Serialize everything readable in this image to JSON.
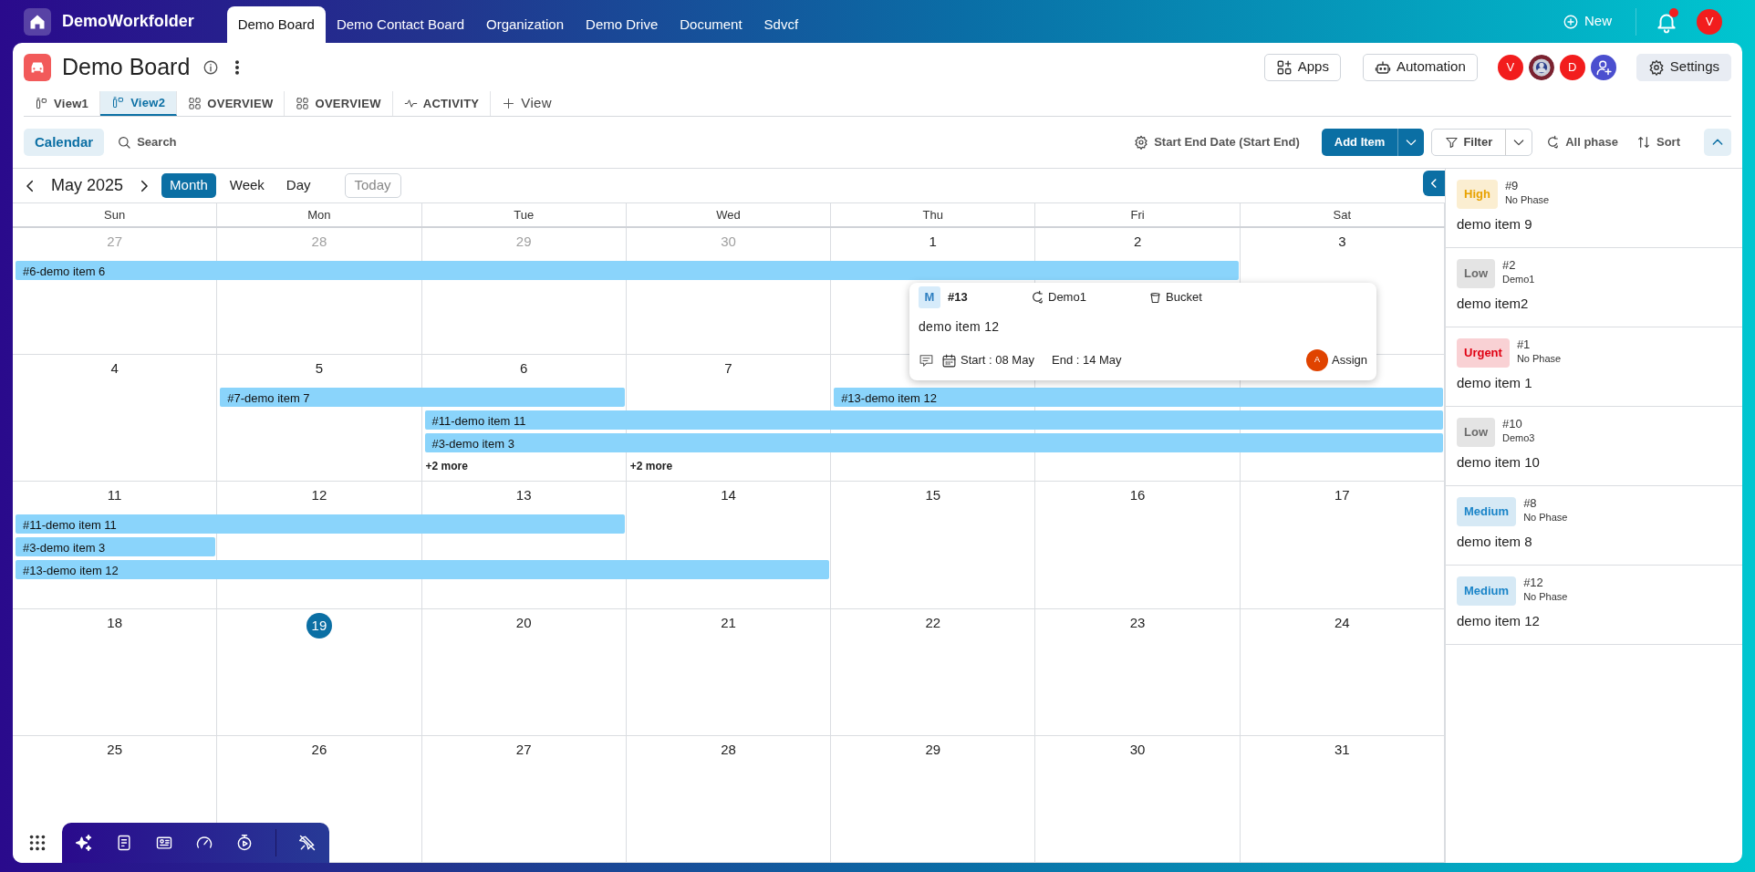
{
  "top_nav": {
    "brand": "DemoWorkfolder",
    "tabs": [
      {
        "label": "Demo Board",
        "selected": true
      },
      {
        "label": "Demo Contact Board",
        "selected": false
      },
      {
        "label": "Organization",
        "selected": false
      },
      {
        "label": "Demo Drive",
        "selected": false
      },
      {
        "label": "Document",
        "selected": false
      },
      {
        "label": "Sdvcf",
        "selected": false
      }
    ],
    "new_button": "New",
    "notifications": {
      "unread": true
    },
    "user_initial": "V"
  },
  "board": {
    "title": "Demo Board",
    "views": [
      {
        "label": "View1",
        "kind": "board",
        "selected": false
      },
      {
        "label": "View2",
        "kind": "board",
        "selected": true
      },
      {
        "label": "OVERVIEW",
        "kind": "overview",
        "selected": false
      },
      {
        "label": "OVERVIEW",
        "kind": "overview",
        "selected": false
      },
      {
        "label": "ACTIVITY",
        "kind": "activity",
        "selected": false
      }
    ],
    "add_view": "View",
    "apps_button": "Apps",
    "automation_button": "Automation",
    "members": [
      {
        "kind": "letter",
        "initial": "V"
      },
      {
        "kind": "picture"
      },
      {
        "kind": "letter",
        "initial": "D"
      }
    ],
    "settings_button": "Settings"
  },
  "toolbar": {
    "calendar_tab": "Calendar",
    "search": "Search",
    "date_fields": "Start End Date (Start End)",
    "add_item": "Add Item",
    "filter": "Filter",
    "phase": "All phase",
    "sort": "Sort"
  },
  "calendar": {
    "month": "May 2025",
    "modes": [
      {
        "label": "Month",
        "selected": true
      },
      {
        "label": "Week",
        "selected": false
      },
      {
        "label": "Day",
        "selected": false
      }
    ],
    "today_button": {
      "label": "Today",
      "disabled": true
    },
    "weekdays": [
      "Sun",
      "Mon",
      "Tue",
      "Wed",
      "Thu",
      "Fri",
      "Sat"
    ],
    "weeks": [
      {
        "days": [
          {
            "label": "27",
            "kind": "outside"
          },
          {
            "label": "28",
            "kind": "outside"
          },
          {
            "label": "29",
            "kind": "outside"
          },
          {
            "label": "30",
            "kind": "outside"
          },
          {
            "label": "1",
            "kind": "current"
          },
          {
            "label": "2",
            "kind": "current"
          },
          {
            "label": "3",
            "kind": "current"
          }
        ],
        "lanes": [
          [
            {
              "kind": "start",
              "label": "#6-demo item 6"
            },
            {
              "kind": "continue"
            },
            {
              "kind": "continue"
            },
            {
              "kind": "continue"
            },
            {
              "kind": "continue"
            },
            {
              "kind": "continue"
            }
          ]
        ]
      },
      {
        "days": [
          {
            "label": "4",
            "kind": "current"
          },
          {
            "label": "5",
            "kind": "current"
          },
          {
            "label": "6",
            "kind": "current"
          },
          {
            "label": "7",
            "kind": "current"
          },
          {
            "kind": "covered"
          },
          {
            "kind": "covered"
          },
          {
            "kind": "covered"
          }
        ],
        "lanes": [
          [
            {
              "kind": "empty"
            },
            {
              "kind": "start",
              "label": "#7-demo item 7"
            },
            {
              "kind": "continue"
            },
            {
              "kind": "empty"
            },
            {
              "kind": "start",
              "label": "#13-demo item 12"
            },
            {
              "kind": "continue"
            },
            {
              "kind": "continue"
            }
          ],
          [
            {
              "kind": "empty"
            },
            {
              "kind": "empty"
            },
            {
              "kind": "start",
              "label": "#11-demo item 11"
            },
            {
              "kind": "continue"
            },
            {
              "kind": "continue"
            },
            {
              "kind": "continue"
            },
            {
              "kind": "continue"
            }
          ],
          [
            {
              "kind": "empty"
            },
            {
              "kind": "empty"
            },
            {
              "kind": "start",
              "label": "#3-demo item 3"
            },
            {
              "kind": "continue"
            },
            {
              "kind": "continue"
            },
            {
              "kind": "continue"
            },
            {
              "kind": "continue"
            }
          ],
          [
            {
              "kind": "empty"
            },
            {
              "kind": "empty"
            },
            {
              "kind": "more",
              "label": "+2 more"
            },
            {
              "kind": "more",
              "label": "+2 more"
            }
          ]
        ]
      },
      {
        "days": [
          {
            "label": "11",
            "kind": "current"
          },
          {
            "label": "12",
            "kind": "current"
          },
          {
            "label": "13",
            "kind": "current"
          },
          {
            "label": "14",
            "kind": "current"
          },
          {
            "label": "15",
            "kind": "current"
          },
          {
            "label": "16",
            "kind": "current"
          },
          {
            "label": "17",
            "kind": "current"
          }
        ],
        "lanes": [
          [
            {
              "kind": "start",
              "label": "#11-demo item 11"
            },
            {
              "kind": "continue"
            },
            {
              "kind": "continue"
            }
          ],
          [
            {
              "kind": "start",
              "label": "#3-demo item 3"
            }
          ],
          [
            {
              "kind": "start",
              "label": "#13-demo item 12"
            },
            {
              "kind": "continue"
            },
            {
              "kind": "continue"
            },
            {
              "kind": "continue"
            }
          ]
        ]
      },
      {
        "days": [
          {
            "label": "18",
            "kind": "current"
          },
          {
            "label": "19",
            "kind": "today"
          },
          {
            "label": "20",
            "kind": "current"
          },
          {
            "label": "21",
            "kind": "current"
          },
          {
            "label": "22",
            "kind": "current"
          },
          {
            "label": "23",
            "kind": "current"
          },
          {
            "label": "24",
            "kind": "current"
          }
        ]
      },
      {
        "days": [
          {
            "label": "25",
            "kind": "current"
          },
          {
            "label": "26",
            "kind": "current"
          },
          {
            "label": "27",
            "kind": "current"
          },
          {
            "label": "28",
            "kind": "current"
          },
          {
            "label": "29",
            "kind": "current"
          },
          {
            "label": "30",
            "kind": "current"
          },
          {
            "label": "31",
            "kind": "current"
          }
        ]
      }
    ],
    "popup": {
      "badge": "M",
      "number": "#13",
      "phase": "Demo1",
      "bucket": "Bucket",
      "title": "demo item 12",
      "start": "Start : 08 May",
      "end": "End : 14 May",
      "assignee_initial": "A",
      "assign": "Assign"
    }
  },
  "sidebar": {
    "items": [
      {
        "priority": "High",
        "color": "#e8a200",
        "number": "#9",
        "phase": "No Phase",
        "title": "demo item 9"
      },
      {
        "priority": "Low",
        "color": "#6b6b6b",
        "number": "#2",
        "phase": "Demo1",
        "title": "demo item2"
      },
      {
        "priority": "Urgent",
        "color": "#e00012",
        "number": "#1",
        "phase": "No Phase",
        "title": "demo item 1"
      },
      {
        "priority": "Low",
        "color": "#6b6b6b",
        "number": "#10",
        "phase": "Demo3",
        "title": "demo item 10"
      },
      {
        "priority": "Medium",
        "color": "#1a84c8",
        "number": "#8",
        "phase": "No Phase",
        "title": "demo item 8"
      },
      {
        "priority": "Medium",
        "color": "#1a84c8",
        "number": "#12",
        "phase": "No Phase",
        "title": "demo item 12"
      }
    ]
  }
}
